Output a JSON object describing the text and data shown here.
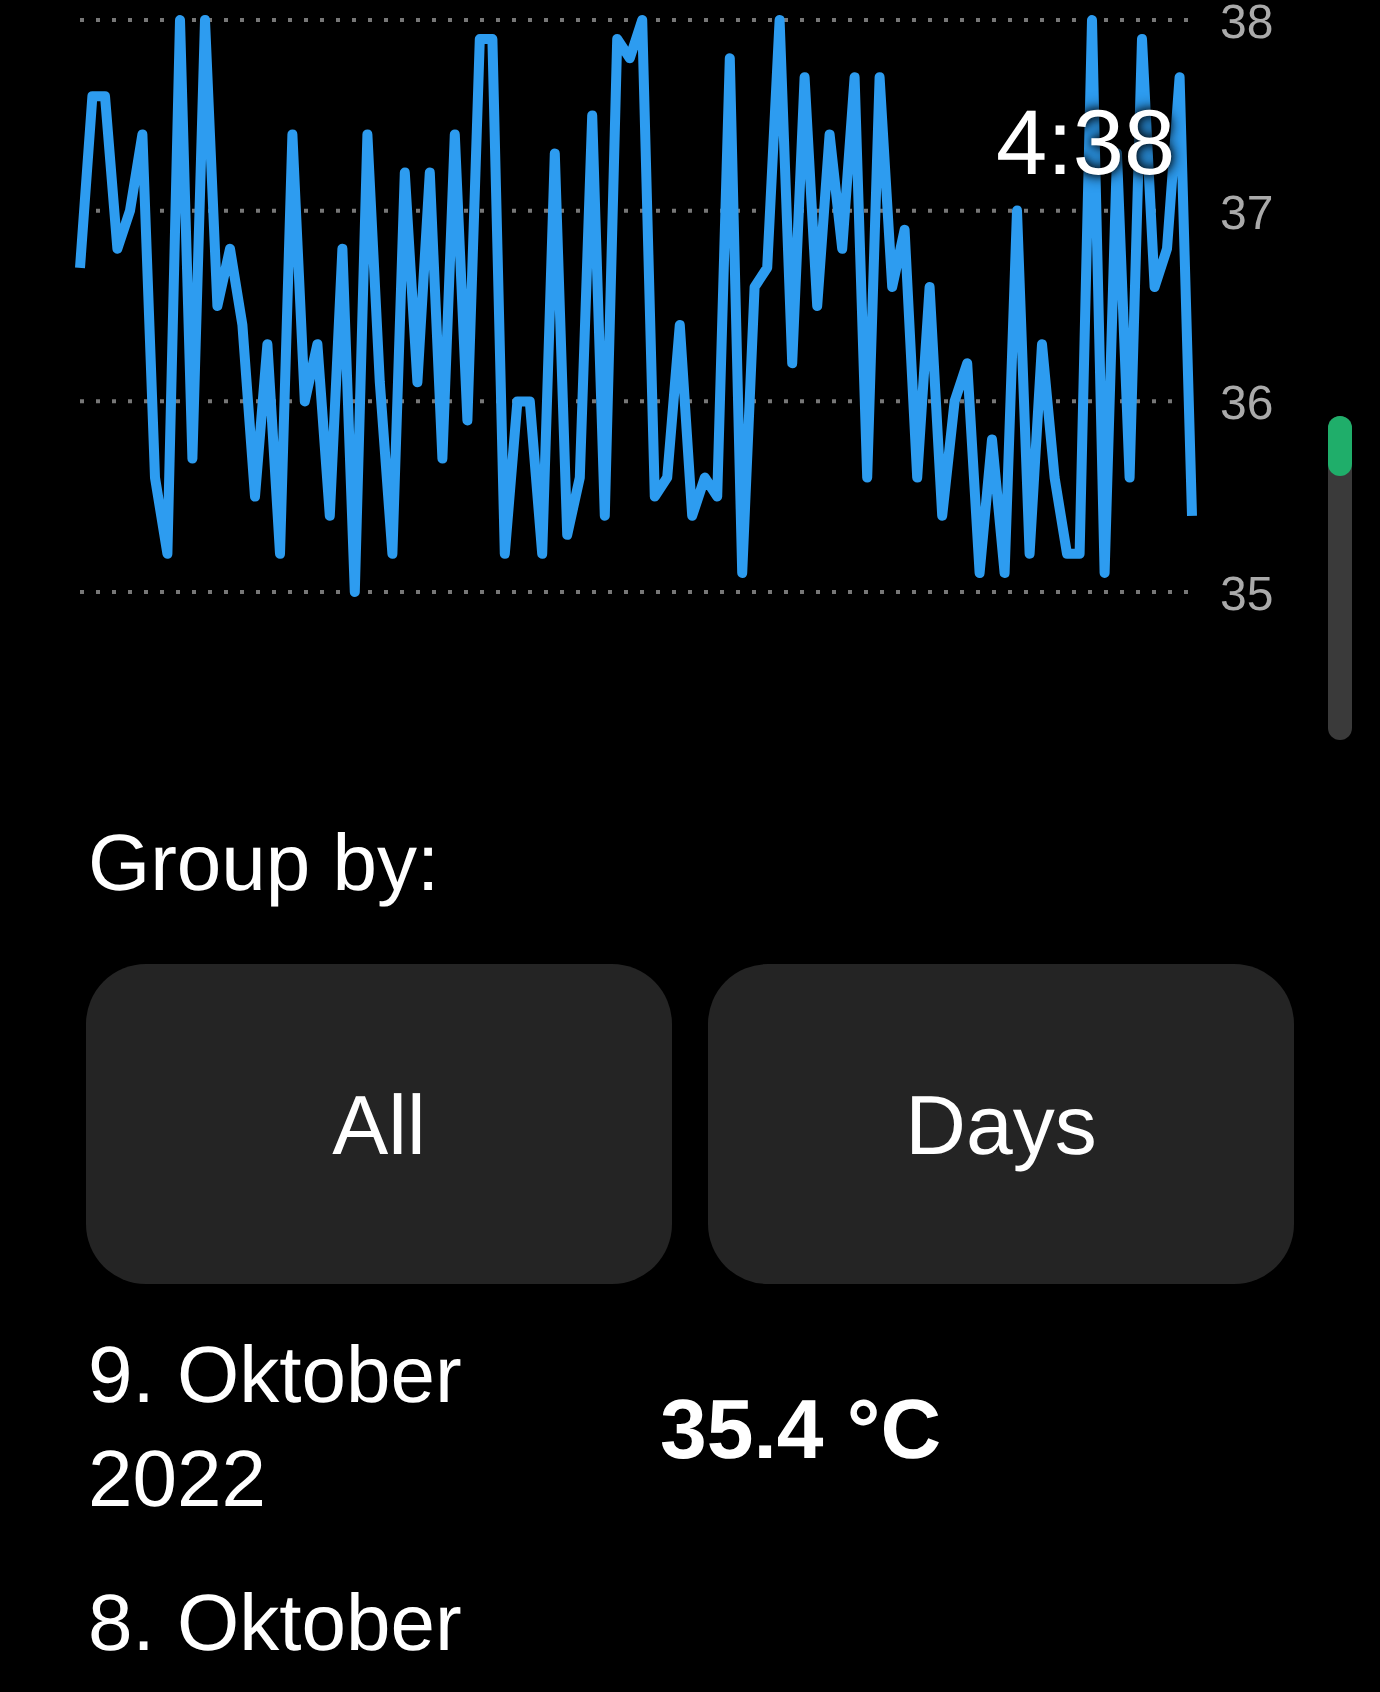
{
  "clock": "4:38",
  "chart_data": {
    "type": "line",
    "yticks": [
      35,
      36,
      37,
      38
    ],
    "ylim": [
      35,
      38
    ],
    "series": [
      {
        "color": "#2d9cf0",
        "values": [
          36.7,
          37.6,
          37.6,
          36.8,
          37.0,
          37.4,
          35.6,
          35.2,
          38.0,
          35.7,
          38.0,
          36.5,
          36.8,
          36.4,
          35.5,
          36.3,
          35.2,
          37.4,
          36.0,
          36.3,
          35.4,
          36.8,
          35.0,
          37.4,
          36.1,
          35.2,
          37.2,
          36.1,
          37.2,
          35.7,
          37.4,
          35.9,
          37.9,
          37.9,
          35.2,
          36.0,
          36.0,
          35.2,
          37.3,
          35.3,
          35.6,
          37.5,
          35.4,
          37.9,
          37.8,
          38.0,
          35.5,
          35.6,
          36.4,
          35.4,
          35.6,
          35.5,
          37.8,
          35.1,
          36.6,
          36.7,
          38.0,
          36.2,
          37.7,
          36.5,
          37.4,
          36.8,
          37.7,
          35.6,
          37.7,
          36.6,
          36.9,
          35.6,
          36.6,
          35.4,
          36.0,
          36.2,
          35.1,
          35.8,
          35.1,
          37.0,
          35.2,
          36.3,
          35.6,
          35.2,
          35.2,
          38.0,
          35.1,
          37.3,
          35.6,
          37.9,
          36.6,
          36.8,
          37.7,
          35.4
        ]
      }
    ]
  },
  "group_by": {
    "label": "Group by:",
    "buttons": [
      "All",
      "Days"
    ]
  },
  "entries": [
    {
      "date": "9. Oktober 2022",
      "value": "35.4 °C"
    },
    {
      "date": "8. Oktober"
    }
  ]
}
